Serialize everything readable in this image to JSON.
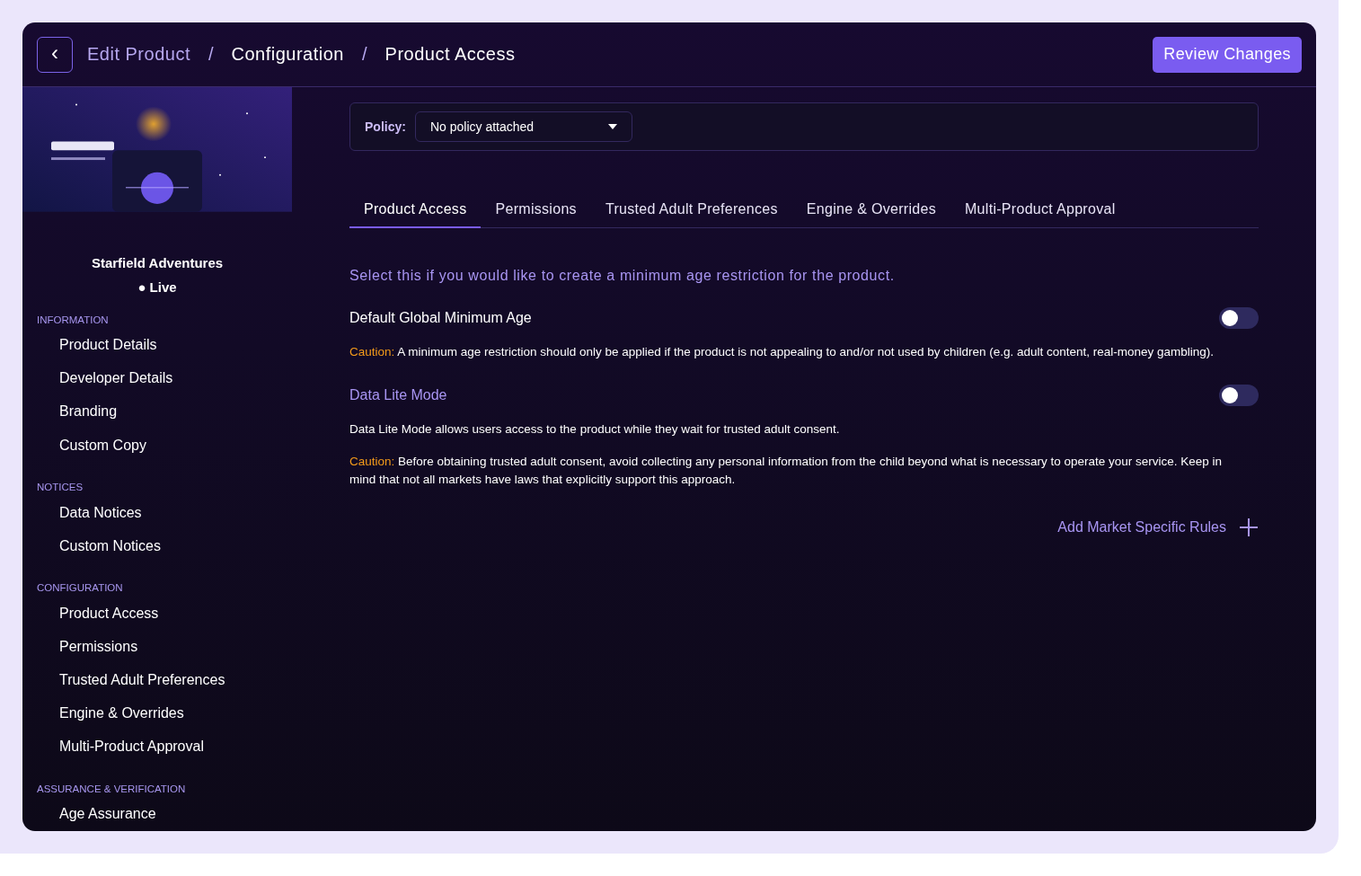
{
  "header": {
    "back_label": "‹",
    "breadcrumbs": [
      {
        "label": "Edit Product",
        "current": false
      },
      {
        "label": "Configuration",
        "current": true
      },
      {
        "label": "Product Access",
        "current": true
      }
    ],
    "separator": "/",
    "action": "Review Changes"
  },
  "sidebar": {
    "product_name": "Starfield Adventures",
    "status": "● Live",
    "sections": [
      {
        "title": "INFORMATION",
        "items": [
          "Product Details",
          "Developer Details",
          "Branding",
          "Custom Copy"
        ]
      },
      {
        "title": "NOTICES",
        "items": [
          "Data Notices",
          "Custom Notices"
        ]
      },
      {
        "title": "CONFIGURATION",
        "items": [
          "Product Access",
          "Permissions",
          "Trusted Adult Preferences",
          "Engine & Overrides",
          "Multi-Product Approval"
        ]
      },
      {
        "title": "ASSURANCE & VERIFICATION",
        "items": [
          "Age Assurance"
        ]
      }
    ]
  },
  "policy": {
    "label": "Policy:",
    "value": "No policy attached"
  },
  "tabs": [
    {
      "label": "Product Access",
      "selected": true
    },
    {
      "label": "Permissions",
      "selected": false
    },
    {
      "label": "Trusted Adult Preferences",
      "selected": false
    },
    {
      "label": "Engine & Overrides",
      "selected": false
    },
    {
      "label": "Multi-Product Approval",
      "selected": false
    }
  ],
  "intro": "Select this if you would like to create a minimum age restriction for the product.",
  "settings": [
    {
      "label": "Default Global Minimum Age",
      "accent": false,
      "on": false,
      "notes": [
        {
          "caution": "Caution:",
          "text": "A minimum age restriction should only be applied if the product is not appealing to and/or not used by children (e.g. adult content, real-money gambling)."
        }
      ]
    },
    {
      "label": "Data Lite Mode",
      "accent": true,
      "on": false,
      "notes": [
        {
          "text": "Data Lite Mode allows users access to the product while they wait for trusted adult consent."
        },
        {
          "caution": "Caution:",
          "text": "Before obtaining trusted adult consent, avoid collecting any personal information from the child beyond what is necessary to operate your service. Keep in mind that not all markets have laws that explicitly support this approach."
        }
      ]
    }
  ],
  "add_rules": "Add Market Specific Rules"
}
